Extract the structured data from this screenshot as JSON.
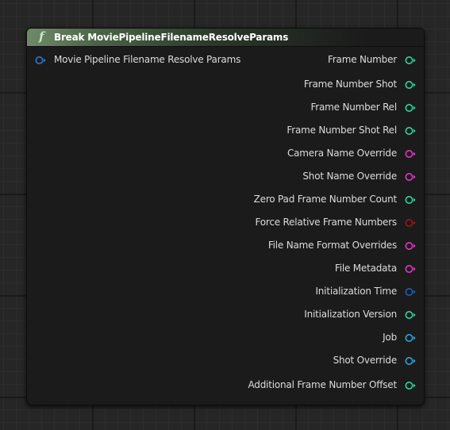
{
  "node": {
    "title": "Break MoviePipelineFilenameResolveParams",
    "function_icon": "f",
    "input_pin": {
      "label": "Movie Pipeline Filename Resolve Params",
      "color": "#2e78d6"
    },
    "output_pins": [
      {
        "label": "Frame Number",
        "color": "#2ed6a3"
      },
      {
        "label": "Frame Number Shot",
        "color": "#2ed6a3"
      },
      {
        "label": "Frame Number Rel",
        "color": "#2ed6a3"
      },
      {
        "label": "Frame Number Shot Rel",
        "color": "#2ed6a3"
      },
      {
        "label": "Camera Name Override",
        "color": "#e236c9"
      },
      {
        "label": "Shot Name Override",
        "color": "#e236c9"
      },
      {
        "label": "Zero Pad Frame Number Count",
        "color": "#2ed6a3"
      },
      {
        "label": "Force Relative Frame Numbers",
        "color": "#a0141b"
      },
      {
        "label": "File Name Format Overrides",
        "color": "#e236c9"
      },
      {
        "label": "File Metadata",
        "color": "#e236c9"
      },
      {
        "label": "Initialization Time",
        "color": "#1f5fb3"
      },
      {
        "label": "Initialization Version",
        "color": "#2ed6a3"
      },
      {
        "label": "Job",
        "color": "#29a8e0"
      },
      {
        "label": "Shot Override",
        "color": "#29a8e0"
      },
      {
        "label": "Additional Frame Number Offset",
        "color": "#2ed6a3"
      }
    ]
  }
}
